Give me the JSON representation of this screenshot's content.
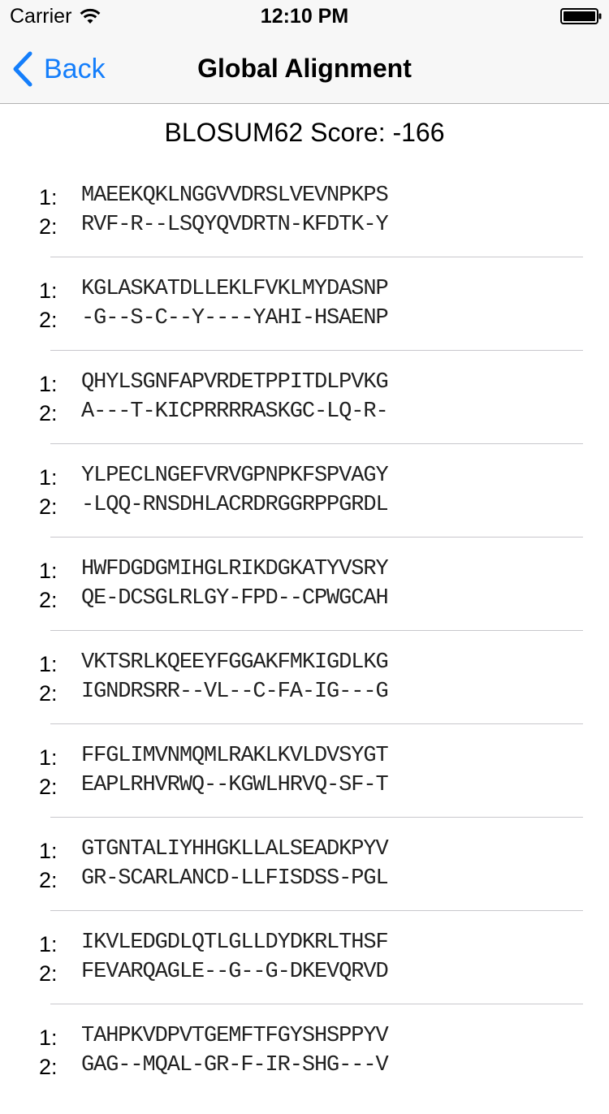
{
  "status_bar": {
    "carrier": "Carrier",
    "time": "12:10 PM",
    "icons": [
      "wifi-icon",
      "battery-icon"
    ]
  },
  "nav": {
    "back_label": "Back",
    "title": "Global Alignment",
    "accent_color": "#147efb"
  },
  "score": "BLOSUM62 Score: -166",
  "blocks": [
    {
      "label1": "1:",
      "seq1": "MAEEKQKLNGGVVDRSLVEVNPKPS",
      "label2": "2:",
      "seq2": "RVF-R--LSQYQVDRTN-KFDTK-Y"
    },
    {
      "label1": "1:",
      "seq1": "KGLASKATDLLEKLFVKLMYDASNP",
      "label2": "2:",
      "seq2": "-G--S-C--Y----YAHI-HSAENP"
    },
    {
      "label1": "1:",
      "seq1": "QHYLSGNFAPVRDETPPITDLPVKG",
      "label2": "2:",
      "seq2": "A---T-KICPRRRRASKGC-LQ-R-"
    },
    {
      "label1": "1:",
      "seq1": "YLPECLNGEFVRVGPNPKFSPVAGY",
      "label2": "2:",
      "seq2": "-LQQ-RNSDHLACRDRGGRPPGRDL"
    },
    {
      "label1": "1:",
      "seq1": "HWFDGDGMIHGLRIKDGKATYVSRY",
      "label2": "2:",
      "seq2": "QE-DCSGLRLGY-FPD--CPWGCAH"
    },
    {
      "label1": "1:",
      "seq1": "VKTSRLKQEEYFGGAKFMKIGDLKG",
      "label2": "2:",
      "seq2": "IGNDRSRR--VL--C-FA-IG---G"
    },
    {
      "label1": "1:",
      "seq1": "FFGLIMVNMQMLRAKLKVLDVSYGT",
      "label2": "2:",
      "seq2": "EAPLRHVRWQ--KGWLHRVQ-SF-T"
    },
    {
      "label1": "1:",
      "seq1": "GTGNTALIYHHGKLLALSEADKPYV",
      "label2": "2:",
      "seq2": "GR-SCARLANCD-LLFISDSS-PGL"
    },
    {
      "label1": "1:",
      "seq1": "IKVLEDGDLQTLGLLDYDKRLTHSF",
      "label2": "2:",
      "seq2": "FEVARQAGLE--G--G-DKEVQRVD"
    },
    {
      "label1": "1:",
      "seq1": "TAHPKVDPVTGEMFTFGYSHSPPYV",
      "label2": "2:",
      "seq2": "GAG--MQAL-GR-F-IR-SHG---V"
    }
  ]
}
